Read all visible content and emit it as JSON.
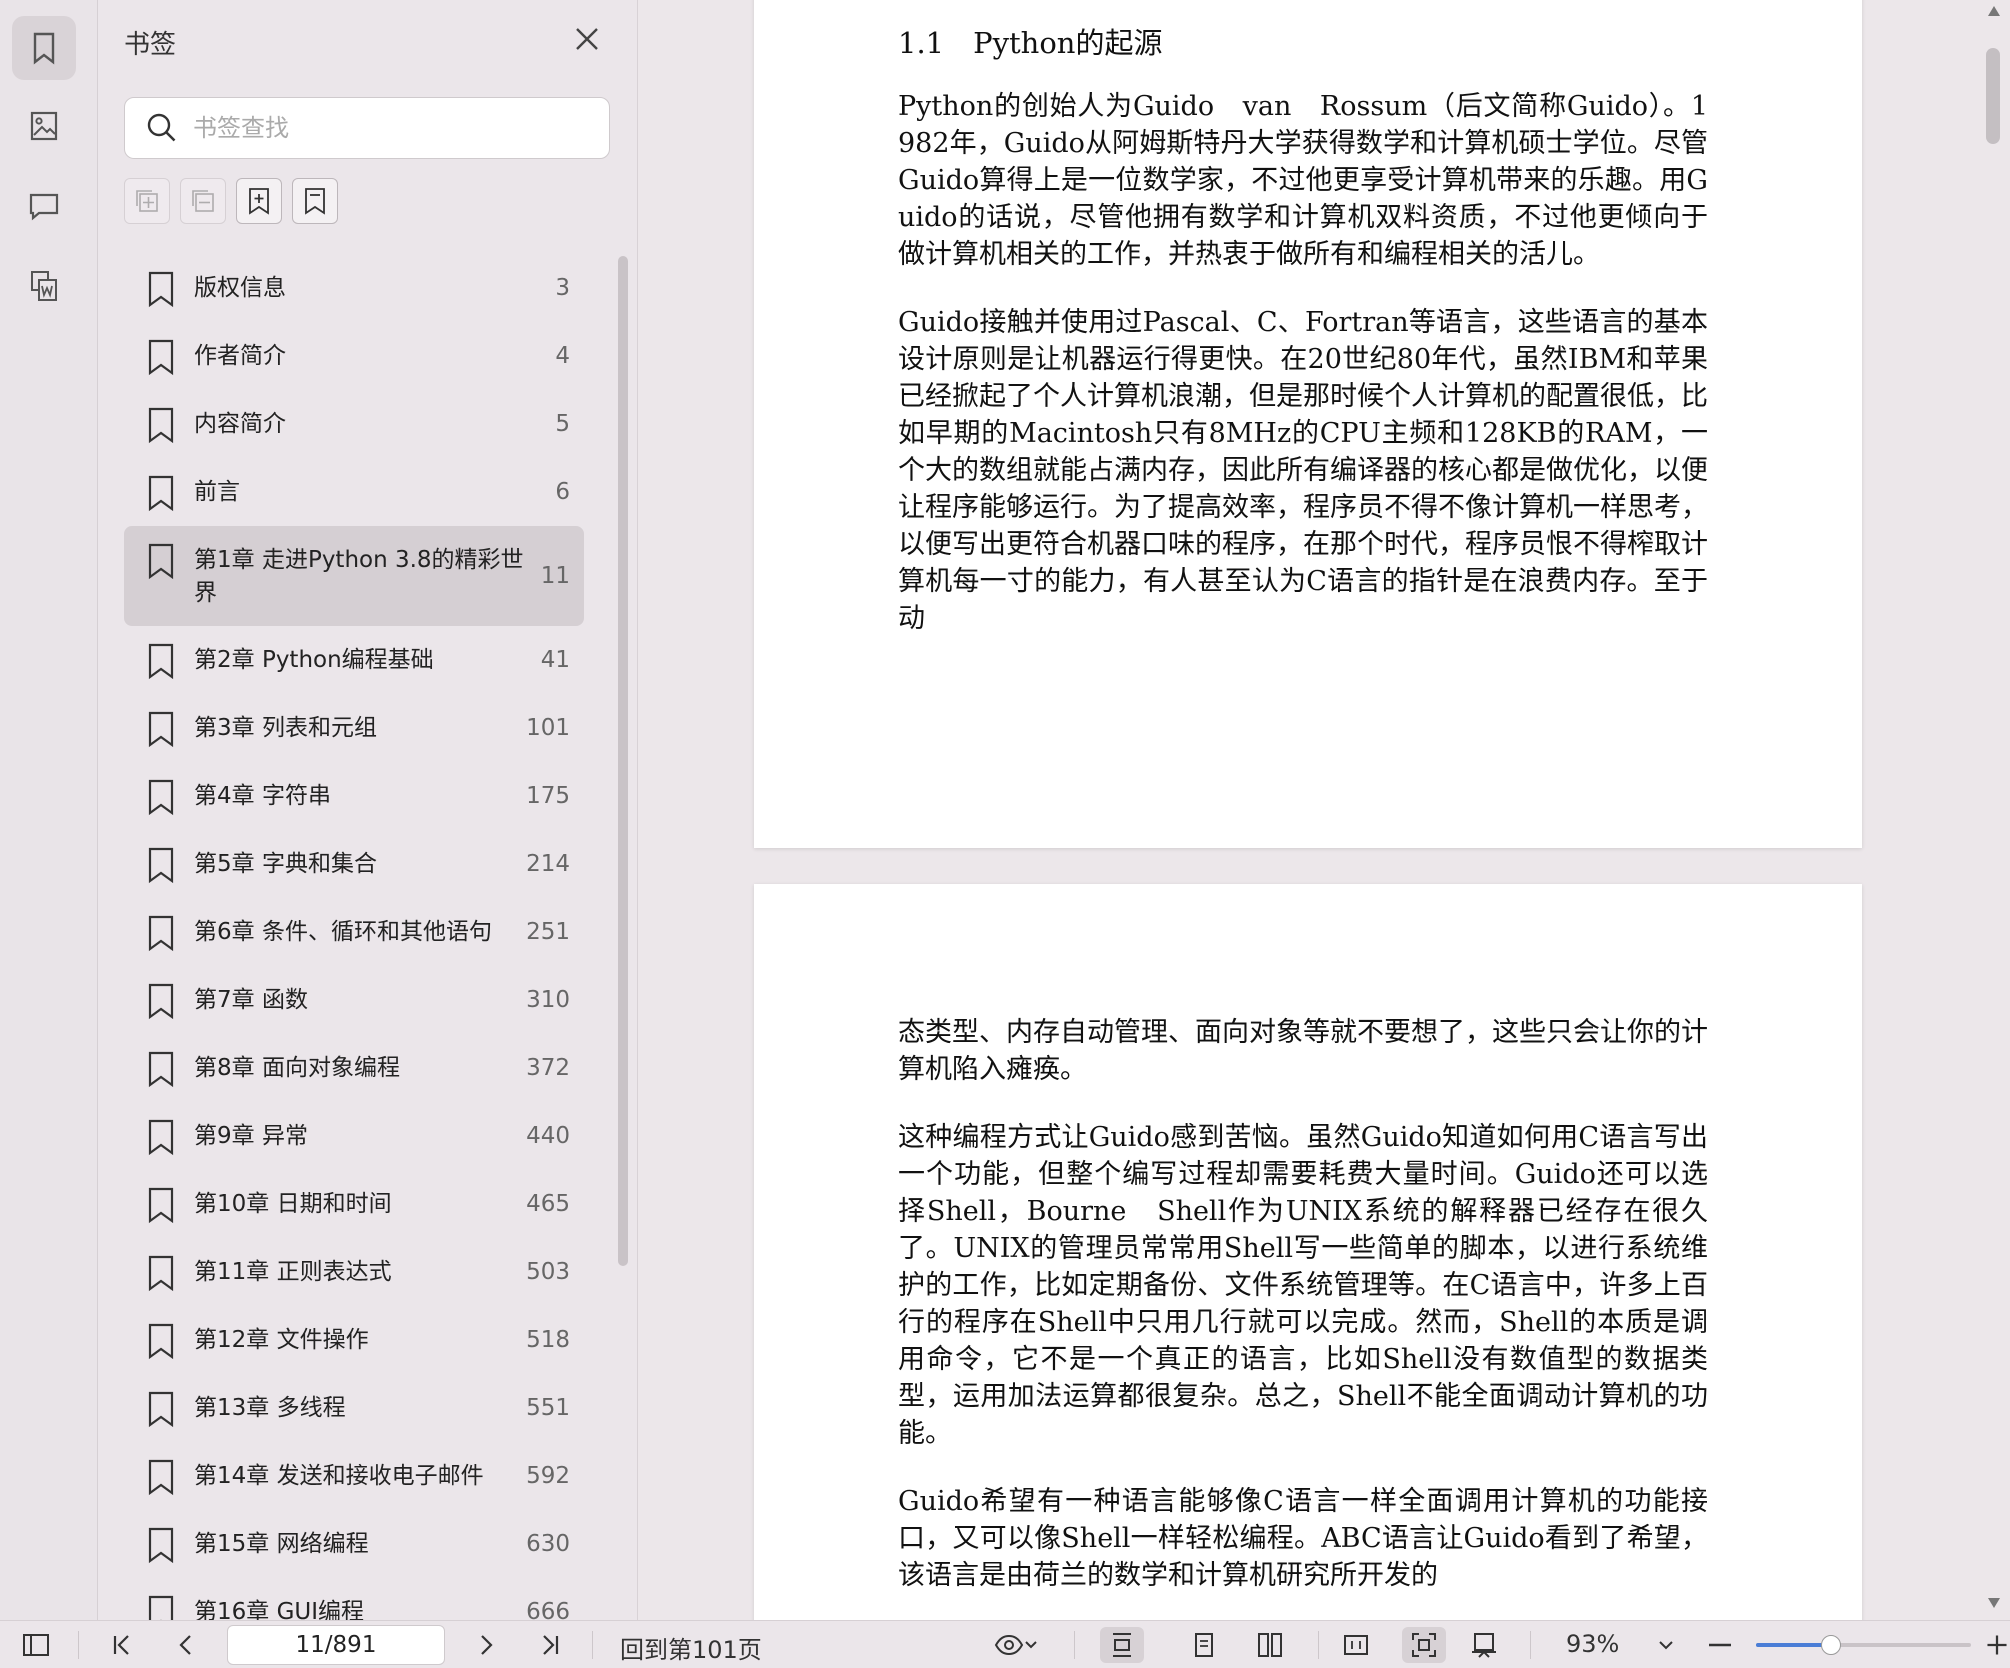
{
  "panel": {
    "title": "书签",
    "search_placeholder": "书签查找"
  },
  "bookmarks": [
    {
      "label": "版权信息",
      "page": "3"
    },
    {
      "label": "作者简介",
      "page": "4"
    },
    {
      "label": "内容简介",
      "page": "5"
    },
    {
      "label": "前言",
      "page": "6"
    },
    {
      "label": "第1章 走进Python 3.8的精彩世界",
      "page": "11",
      "active": true
    },
    {
      "label": "第2章 Python编程基础",
      "page": "41"
    },
    {
      "label": "第3章 列表和元组",
      "page": "101"
    },
    {
      "label": "第4章 字符串",
      "page": "175"
    },
    {
      "label": "第5章 字典和集合",
      "page": "214"
    },
    {
      "label": "第6章 条件、循环和其他语句",
      "page": "251"
    },
    {
      "label": "第7章 函数",
      "page": "310"
    },
    {
      "label": "第8章 面向对象编程",
      "page": "372"
    },
    {
      "label": "第9章 异常",
      "page": "440"
    },
    {
      "label": "第10章 日期和时间",
      "page": "465"
    },
    {
      "label": "第11章 正则表达式",
      "page": "503"
    },
    {
      "label": "第12章 文件操作",
      "page": "518"
    },
    {
      "label": "第13章 多线程",
      "page": "551"
    },
    {
      "label": "第14章 发送和接收电子邮件",
      "page": "592"
    },
    {
      "label": "第15章 网络编程",
      "page": "630"
    },
    {
      "label": "第16章 GUI编程",
      "page": "666"
    }
  ],
  "document": {
    "page1": {
      "heading": "1.1　Python的起源",
      "paragraphs": [
        "Python的创始人为Guido　van　Rossum（后文简称Guido）。1982年，Guido从阿姆斯特丹大学获得数学和计算机硕士学位。尽管Guido算得上是一位数学家，不过他更享受计算机带来的乐趣。用Guido的话说，尽管他拥有数学和计算机双料资质，不过他更倾向于做计算机相关的工作，并热衷于做所有和编程相关的活儿。",
        "Guido接触并使用过Pascal、C、Fortran等语言，这些语言的基本设计原则是让机器运行得更快。在20世纪80年代，虽然IBM和苹果已经掀起了个人计算机浪潮，但是那时候个人计算机的配置很低，比如早期的Macintosh只有8MHz的CPU主频和128KB的RAM，一个大的数组就能占满内存，因此所有编译器的核心都是做优化，以便让程序能够运行。为了提高效率，程序员不得不像计算机一样思考，以便写出更符合机器口味的程序，在那个时代，程序员恨不得榨取计算机每一寸的能力，有人甚至认为C语言的指针是在浪费内存。至于动"
      ]
    },
    "page2": {
      "paragraphs": [
        "态类型、内存自动管理、面向对象等就不要想了，这些只会让你的计算机陷入瘫痪。",
        "这种编程方式让Guido感到苦恼。虽然Guido知道如何用C语言写出一个功能，但整个编写过程却需要耗费大量时间。Guido还可以选择Shell，Bourne　Shell作为UNIX系统的解释器已经存在很久了。UNIX的管理员常常用Shell写一些简单的脚本，以进行系统维护的工作，比如定期备份、文件系统管理等。在C语言中，许多上百行的程序在Shell中只用几行就可以完成。然而，Shell的本质是调用命令，它不是一个真正的语言，比如Shell没有数值型的数据类型，运用加法运算都很复杂。总之，Shell不能全面调动计算机的功能。",
        "Guido希望有一种语言能够像C语言一样全面调用计算机的功能接口，又可以像Shell一样轻松编程。ABC语言让Guido看到了希望，该语言是由荷兰的数学和计算机研究所开发的"
      ]
    }
  },
  "statusbar": {
    "page_indicator": "11/891",
    "goto_label": "回到第101页",
    "zoom": "93%",
    "zoom_fraction": 0.35
  }
}
